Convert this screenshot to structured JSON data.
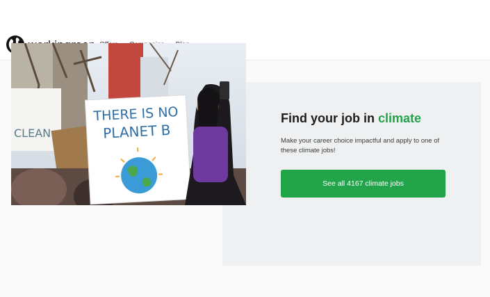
{
  "brand": {
    "name": "workingreen",
    "icon": "globe-icon"
  },
  "nav": {
    "items": [
      "Offers",
      "Companies",
      "Blog"
    ]
  },
  "hero": {
    "sign_main_line1": "THERE IS NO",
    "sign_main_line2": "PLANET B"
  },
  "cta": {
    "title_prefix": "Find your job in ",
    "title_accent": "climate",
    "description": "Make your career choice impactful and apply to one of these climate jobs!",
    "button_label": "See all 4167 climate jobs"
  },
  "colors": {
    "accent": "#22a34a",
    "button": "#21a44a",
    "panel": "#eef0f1"
  }
}
